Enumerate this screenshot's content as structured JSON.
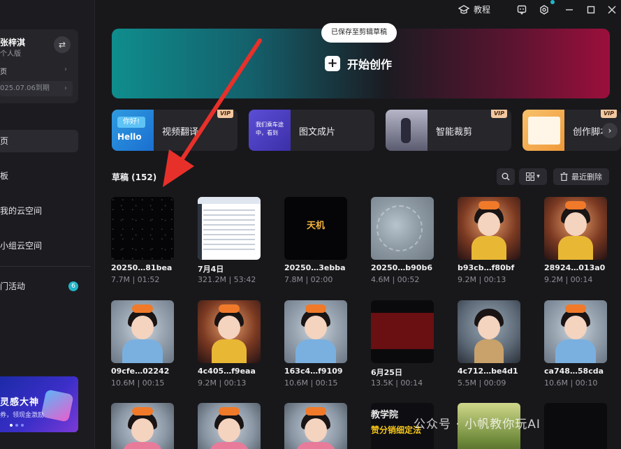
{
  "user": {
    "name": "张梓淇",
    "plan": "个人版",
    "row1": "页",
    "expiry": "025.07.06到期"
  },
  "nav": {
    "home": "页",
    "templates": "板",
    "my_cloud": "我的云空间",
    "team_cloud": "小组云空间",
    "events": "门活动",
    "events_badge": "6"
  },
  "banner": {
    "title": "灵感大神",
    "subtitle": "券，领现金激励"
  },
  "titlebar": {
    "tutorial": "教程"
  },
  "hero": {
    "start_label": "开始创作",
    "toast": "已保存至剪辑草稿"
  },
  "tiles": [
    {
      "label": "视频翻译",
      "vip": "VIP",
      "thumb_top": "你好!",
      "thumb_bottom": "Hello"
    },
    {
      "label": "图文成片",
      "thumb_text": "我们乘车途中，看到"
    },
    {
      "label": "智能裁剪",
      "vip": "VIP"
    },
    {
      "label": "创作脚本",
      "vip": "VIP"
    }
  ],
  "drafts": {
    "title": "草稿 (152)",
    "recent_delete": "最近删除"
  },
  "cards": [
    {
      "name": "20250…81bea",
      "meta": "7.7M | 01:52"
    },
    {
      "name": "7月4日",
      "meta": "321.2M | 53:42"
    },
    {
      "name": "20250…3ebba",
      "meta": "7.8M | 02:00",
      "thumb_text": "天机"
    },
    {
      "name": "20250…b90b6",
      "meta": "4.6M | 00:52"
    },
    {
      "name": "b93cb…f80bf",
      "meta": "9.2M | 00:13"
    },
    {
      "name": "28924…013a0",
      "meta": "9.2M | 00:14"
    },
    {
      "name": "09cfe…02242",
      "meta": "10.6M | 00:15"
    },
    {
      "name": "4c405…f9eaa",
      "meta": "9.2M | 00:13"
    },
    {
      "name": "163c4…f9109",
      "meta": "10.6M | 00:15"
    },
    {
      "name": "6月25日",
      "meta": "13.5K | 00:14"
    },
    {
      "name": "4c712…be4d1",
      "meta": "5.5M | 00:09"
    },
    {
      "name": "ca748…58cda",
      "meta": "10.6M | 00:10"
    }
  ],
  "row3": {
    "school_line1": "教学院",
    "school_line2": "赞分销细定法"
  },
  "watermark": "公众号 · 小帆教你玩AI",
  "colors": {
    "accent": "#22b5c8",
    "background": "#18181b",
    "arrow": "#e8302a"
  },
  "icons": [
    "graduation-cap-icon",
    "feedback-icon",
    "settings-icon",
    "minimize-icon",
    "maximize-icon",
    "close-icon",
    "search-icon",
    "grid-view-icon",
    "trash-icon"
  ]
}
